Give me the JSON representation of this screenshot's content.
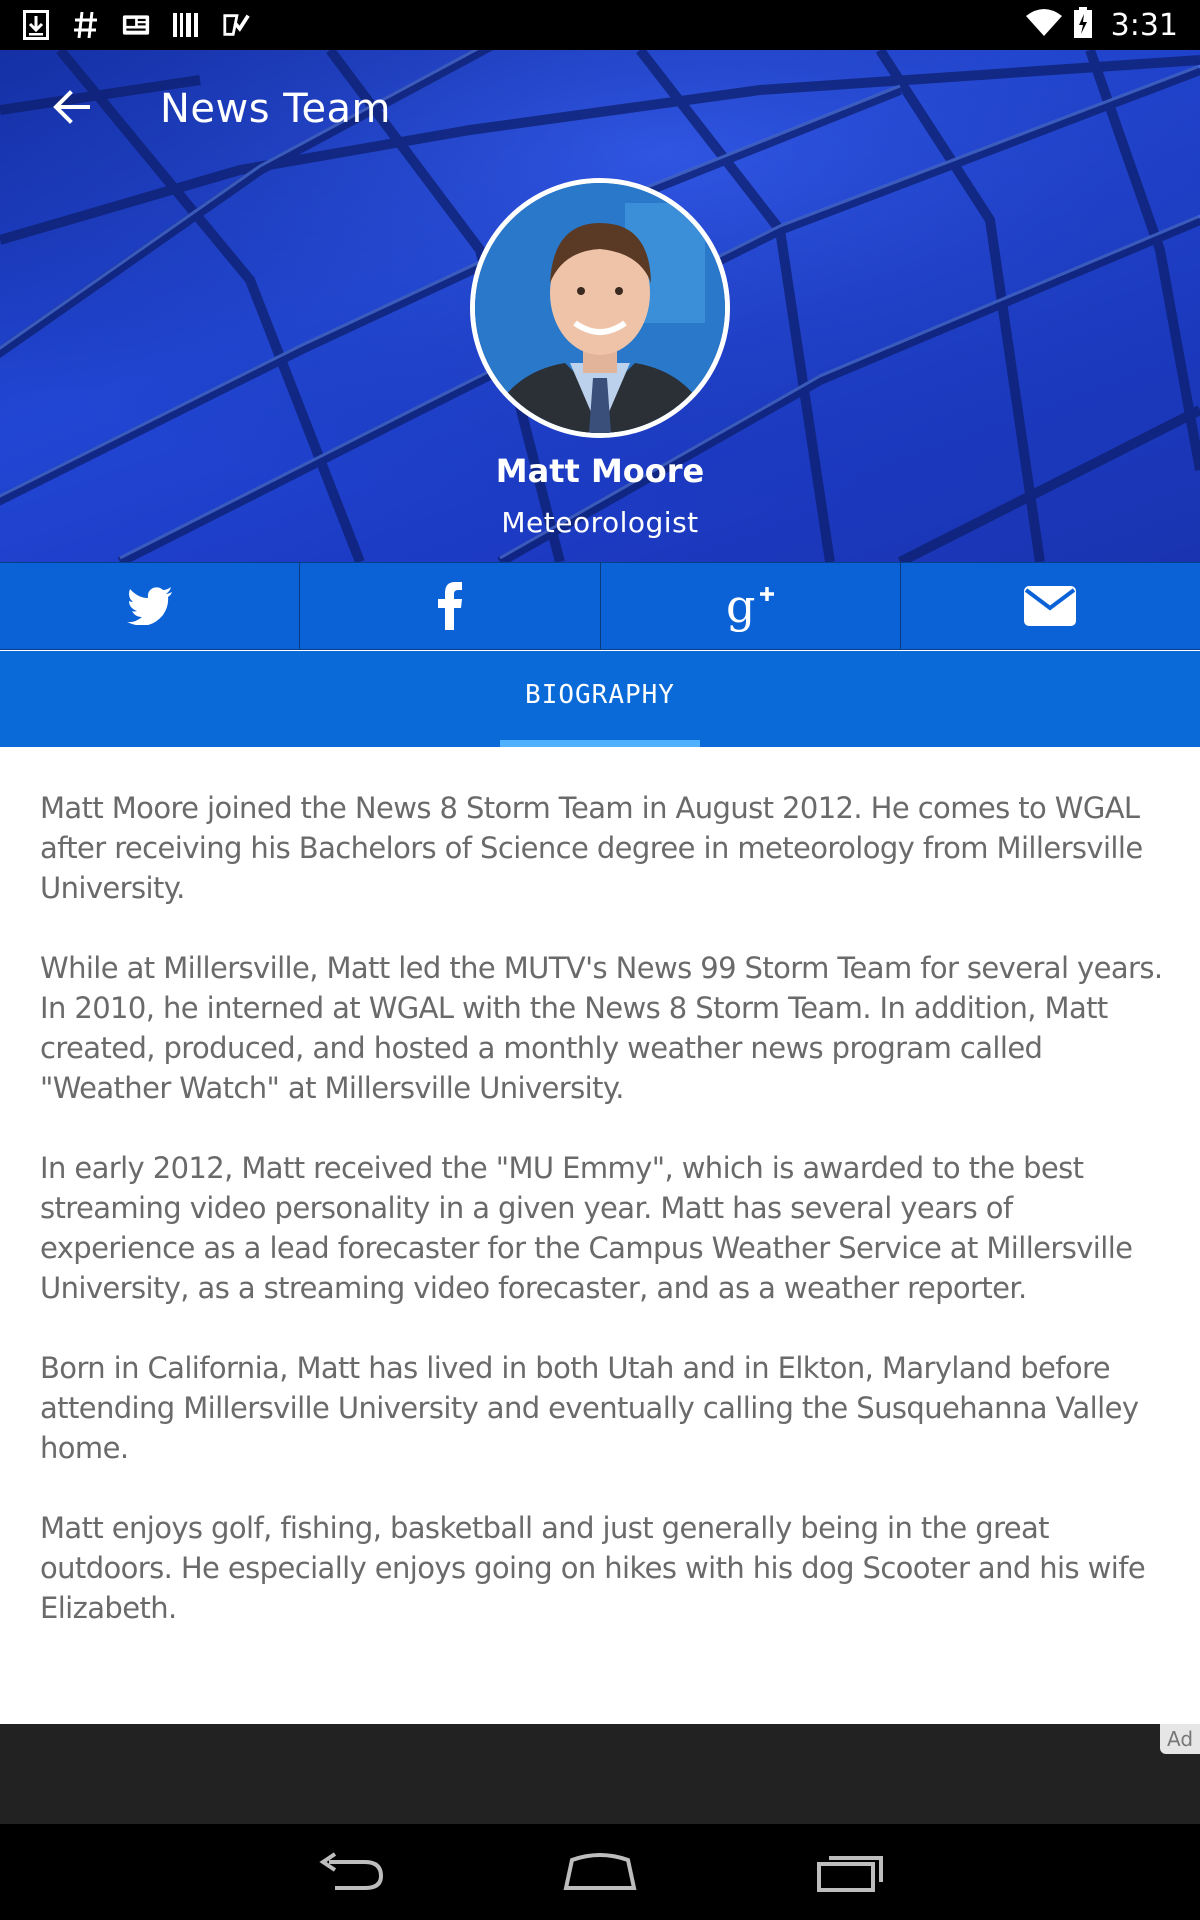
{
  "status_bar": {
    "time": "3:31",
    "left_icons": [
      "download-icon",
      "hashtag-icon",
      "news-icon",
      "barcode-icon",
      "checklist-icon"
    ],
    "right_icons": [
      "wifi-icon",
      "battery-charging-icon"
    ]
  },
  "app_bar": {
    "title": "News Team",
    "back_icon": "arrow-left-icon"
  },
  "profile": {
    "name": "Matt Moore",
    "role": "Meteorologist"
  },
  "social": [
    {
      "name": "twitter",
      "icon": "twitter-icon"
    },
    {
      "name": "facebook",
      "icon": "facebook-icon"
    },
    {
      "name": "google-plus",
      "icon": "google-plus-icon"
    },
    {
      "name": "email",
      "icon": "envelope-icon"
    }
  ],
  "tabs": [
    {
      "label": "BIOGRAPHY",
      "active": true
    }
  ],
  "biography": [
    "Matt Moore joined the News 8 Storm Team in August 2012. He comes to WGAL after receiving his Bachelors of Science degree in meteorology from Millersville University.",
    "While at Millersville, Matt led the MUTV's News 99 Storm Team for several years. In 2010, he interned at WGAL with the News 8 Storm Team. In addition, Matt created, produced, and hosted a monthly weather news program called \"Weather Watch\" at Millersville University.",
    "In early 2012, Matt received the \"MU Emmy\", which is awarded to the best streaming video personality in a given year. Matt has several years of experience as a lead forecaster for the Campus Weather Service at Millersville University, as a streaming video forecaster, and as a weather reporter.",
    "Born in California, Matt has lived in both Utah and in Elkton, Maryland before attending Millersville University and eventually calling the Susquehanna Valley home.",
    "Matt enjoys golf, fishing, basketball and just generally being in the great outdoors. He especially enjoys going on hikes with his dog Scooter and his wife Elizabeth."
  ],
  "ad": {
    "badge": "Ad"
  },
  "nav_bar": {
    "buttons": [
      "back-nav-icon",
      "home-nav-icon",
      "recents-nav-icon"
    ]
  },
  "colors": {
    "hero_blue": "#1c3bc4",
    "social_blue": "#0a62d6",
    "tab_blue": "#0a6bd8",
    "tab_indicator": "#4fb0ff",
    "body_text": "#6a6a6a"
  }
}
